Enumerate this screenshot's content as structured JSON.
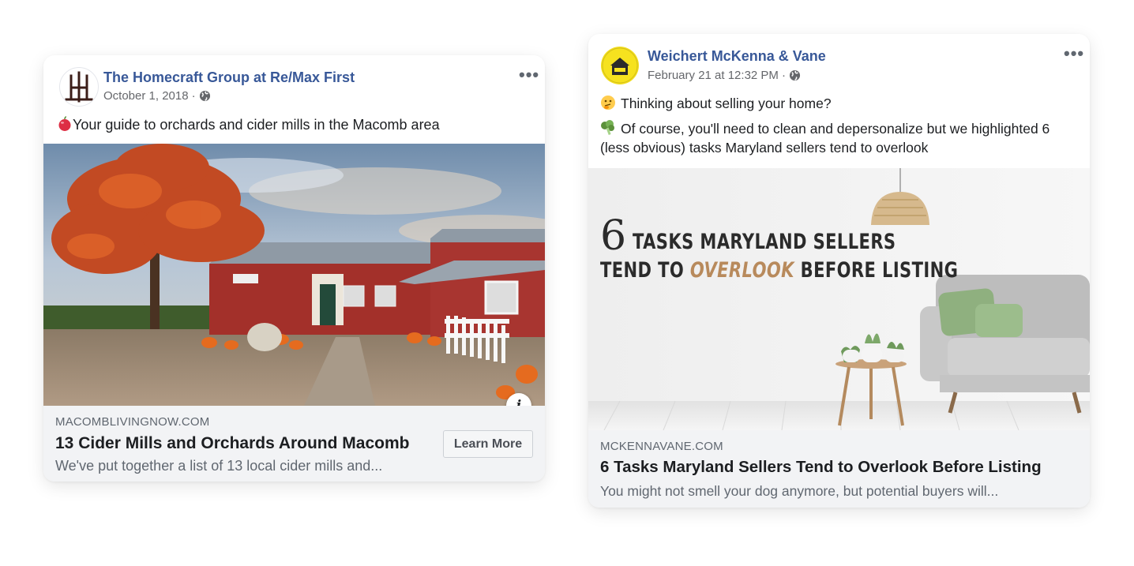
{
  "posts": [
    {
      "page_name": "The Homecraft Group at Re/Max First",
      "date": "October 1, 2018",
      "separator": "·",
      "text": "Your guide to orchards and cider mills in the Macomb area",
      "text_icon": "apple-icon",
      "link": {
        "domain": "MACOMBLIVINGNOW.COM",
        "headline": "13 Cider Mills and Orchards Around Macomb",
        "description": "We've put together a list of 13 local cider mills and...",
        "cta": "Learn More"
      },
      "info_label": "i"
    },
    {
      "page_name": "Weichert McKenna & Vane",
      "date": "February 21 at 12:32 PM",
      "separator": "·",
      "text_line1": "Thinking about selling your home?",
      "text_line1_icon": "thinking-face-icon",
      "text_line2": "Of course, you'll need to clean and depersonalize but we highlighted 6 (less obvious) tasks Maryland sellers tend to overlook",
      "text_line2_icon": "broccoli-icon",
      "image_text": {
        "number": "6",
        "line1": "TASKS MARYLAND SELLERS",
        "line2_a": "TEND TO",
        "line2_highlight": "OVERLOOK",
        "line2_b": "BEFORE LISTING"
      },
      "link": {
        "domain": "MCKENNAVANE.COM",
        "headline": "6 Tasks Maryland Sellers Tend to Overlook Before Listing",
        "description": "You might not smell your dog anymore, but potential buyers will..."
      }
    }
  ],
  "colors": {
    "page_name": "#385898",
    "meta": "#65676b",
    "footer_bg": "#f2f3f5",
    "highlight": "#b88a5c"
  }
}
